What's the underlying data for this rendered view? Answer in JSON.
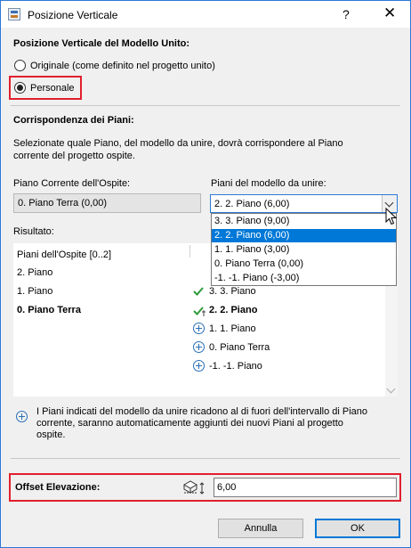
{
  "window": {
    "title": "Posizione Verticale",
    "help": "?",
    "close": "✕"
  },
  "vertical_position": {
    "heading": "Posizione Verticale del Modello Unito:",
    "option_original": "Originale (come definito nel progetto unito)",
    "option_custom": "Personale",
    "selected": "Personale"
  },
  "story_mapping": {
    "heading": "Corrispondenza dei Piani:",
    "description_line1": "Selezionate quale Piano, del modello da unire, dovrà corrispondere al Piano",
    "description_line2": "corrente del progetto ospite.",
    "host_label": "Piano Corrente dell'Ospite:",
    "host_value": "0. Piano Terra (0,00)",
    "merge_label": "Piani del modello da unire:",
    "merge_selected": "2. 2. Piano (6,00)",
    "merge_options": [
      "3. 3. Piano (9,00)",
      "2. 2. Piano (6,00)",
      "1. 1. Piano (3,00)",
      "0. Piano Terra (0,00)",
      "-1. -1. Piano (-3,00)"
    ]
  },
  "result": {
    "label": "Risultato:",
    "host_header": "Piani dell'Ospite [0..2]",
    "host_rows": [
      "2. Piano",
      "1. Piano",
      "0. Piano Terra"
    ],
    "merge_rows": [
      {
        "text": "3. 3. Piano",
        "icon": "check-icon",
        "bold": false
      },
      {
        "text": "2. 2. Piano",
        "icon": "check-anchor-icon",
        "bold": true
      },
      {
        "text": "1. 1. Piano",
        "icon": "plus-circle-icon",
        "bold": false
      },
      {
        "text": "0. Piano Terra",
        "icon": "plus-circle-icon",
        "bold": false
      },
      {
        "text": "-1. -1. Piano",
        "icon": "plus-circle-icon",
        "bold": false
      }
    ]
  },
  "info": {
    "icon": "plus-circle-icon",
    "line1": "I Piani indicati del modello da unire ricadono al di fuori dell'intervallo di Piano",
    "line2": "corrente, saranno automaticamente aggiunti dei nuovi Piani al progetto",
    "line3": "ospite."
  },
  "offset": {
    "label": "Offset Elevazione:",
    "value": "6,00"
  },
  "buttons": {
    "cancel": "Annulla",
    "ok": "OK"
  },
  "colors": {
    "accent": "#0078d7",
    "highlight_box": "#e0202e",
    "check_green": "#2e9a3a",
    "plus_blue": "#2a6fb5"
  }
}
